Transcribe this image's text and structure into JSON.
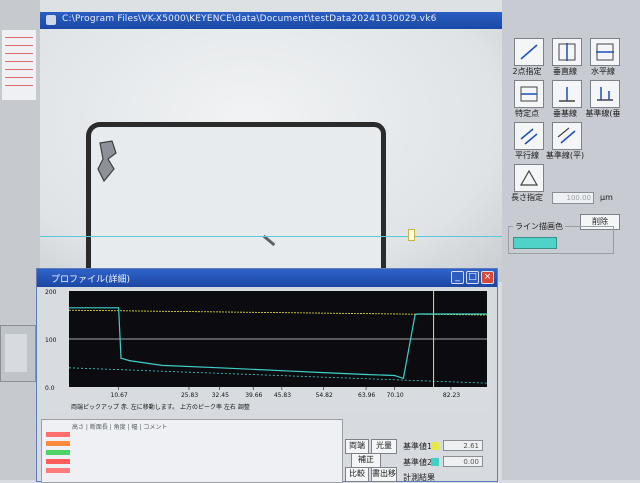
{
  "main_window": {
    "title": "C:\\Program Files\\VK-X5000\\KEYENCE\\data\\Document\\testData20241030029.vk6"
  },
  "toolbar": {
    "tools": [
      {
        "label": "2点指定",
        "icon": "two-point-icon"
      },
      {
        "label": "垂直線",
        "icon": "vertical-line-icon"
      },
      {
        "label": "水平線",
        "icon": "horizontal-line-icon"
      },
      {
        "label": "特定点",
        "icon": "specific-point-icon"
      },
      {
        "label": "垂基線",
        "icon": "perpendicular-icon"
      },
      {
        "label": "基準線(垂",
        "icon": "reference-perp-icon"
      },
      {
        "label": "平行線",
        "icon": "parallel-line-icon"
      },
      {
        "label": "基準線(平)",
        "icon": "reference-parallel-icon"
      },
      {
        "label": "長さ指定",
        "icon": "length-spec-icon"
      }
    ],
    "length_value": "100.00",
    "length_unit": "μm",
    "delete_label": "削除",
    "line_color_label": "ライン描画色",
    "line_color": "#4fd3c8"
  },
  "profile_window": {
    "title": "プロファイル(詳細)",
    "y_ticks": [
      "200",
      "100",
      "0.0"
    ],
    "x_ticks": [
      "10.67",
      "25.83",
      "32.45",
      "39.66",
      "45.83",
      "54.82",
      "63.96",
      "70.10",
      "82.23"
    ],
    "note": "両端ピックアップ 赤. 左に移動します。 上方のピーク率 左右 調整",
    "table_header": "高さ | 断面長 | 角度 | 幅 | コメント",
    "row_colors": [
      "#ff6e6e",
      "#ff8a3d",
      "#4fd369",
      "#ff5c5c",
      "#ff7a7a"
    ],
    "buttons": {
      "left": "両端",
      "scale": "光量",
      "correct": "補正",
      "compare": "比較",
      "output": "書出移"
    },
    "reference_1_label": "基準値1",
    "reference_1_value": "2.61",
    "reference_2_label": "基準値2",
    "reference_2_value": "0.00",
    "calc_label": "計測結果"
  },
  "colors": {
    "title_bar": "#1b48a5",
    "graph_bg": "#0c0c10",
    "profile_trace": "#3fd0c8",
    "reference_yellow": "#e8e84a"
  },
  "chart_data": {
    "type": "line",
    "title": "",
    "xlabel": "",
    "ylabel": "",
    "x": [
      0.0,
      10.67,
      11.2,
      13.0,
      20.0,
      32.45,
      45.83,
      54.82,
      63.96,
      70.1,
      72.0,
      74.5,
      75.0,
      82.23,
      90.0
    ],
    "series": [
      {
        "name": "",
        "values": [
          165,
          165,
          60,
          55,
          45,
          40,
          34,
          30,
          26,
          24,
          18,
          150,
          152,
          152,
          152
        ]
      }
    ],
    "reference_lines": [
      {
        "axis": "y",
        "value": 160
      },
      {
        "axis": "x",
        "value": 78.5
      }
    ],
    "xlim": [
      0,
      90
    ],
    "ylim": [
      0,
      200
    ],
    "grid": false,
    "legend": "none"
  }
}
